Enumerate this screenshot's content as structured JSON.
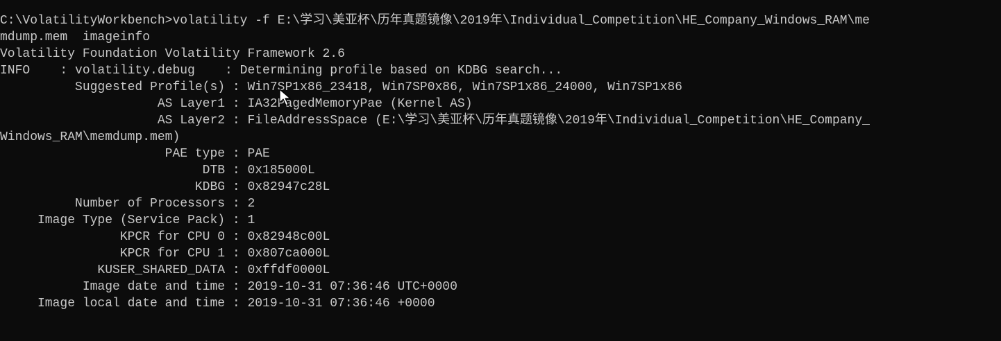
{
  "console": {
    "lines": [
      "C:\\VolatilityWorkbench>volatility -f E:\\学习\\美亚杯\\历年真题镜像\\2019年\\Individual_Competition\\HE_Company_Windows_RAM\\me",
      "mdump.mem  imageinfo",
      "Volatility Foundation Volatility Framework 2.6",
      "INFO    : volatility.debug    : Determining profile based on KDBG search...",
      "          Suggested Profile(s) : Win7SP1x86_23418, Win7SP0x86, Win7SP1x86_24000, Win7SP1x86",
      "                     AS Layer1 : IA32PagedMemoryPae (Kernel AS)",
      "                     AS Layer2 : FileAddressSpace (E:\\学习\\美亚杯\\历年真题镜像\\2019年\\Individual_Competition\\HE_Company_",
      "Windows_RAM\\memdump.mem)",
      "                      PAE type : PAE",
      "                           DTB : 0x185000L",
      "                          KDBG : 0x82947c28L",
      "          Number of Processors : 2",
      "     Image Type (Service Pack) : 1",
      "                KPCR for CPU 0 : 0x82948c00L",
      "                KPCR for CPU 1 : 0x807ca000L",
      "             KUSER_SHARED_DATA : 0xffdf0000L",
      "           Image date and time : 2019-10-31 07:36:46 UTC+0000",
      "     Image local date and time : 2019-10-31 07:36:46 +0000"
    ]
  },
  "icons": {
    "mouse_cursor": "mouse-pointer-icon"
  },
  "colors": {
    "background": "#0c0c0c",
    "text": "#c8c8c8"
  }
}
